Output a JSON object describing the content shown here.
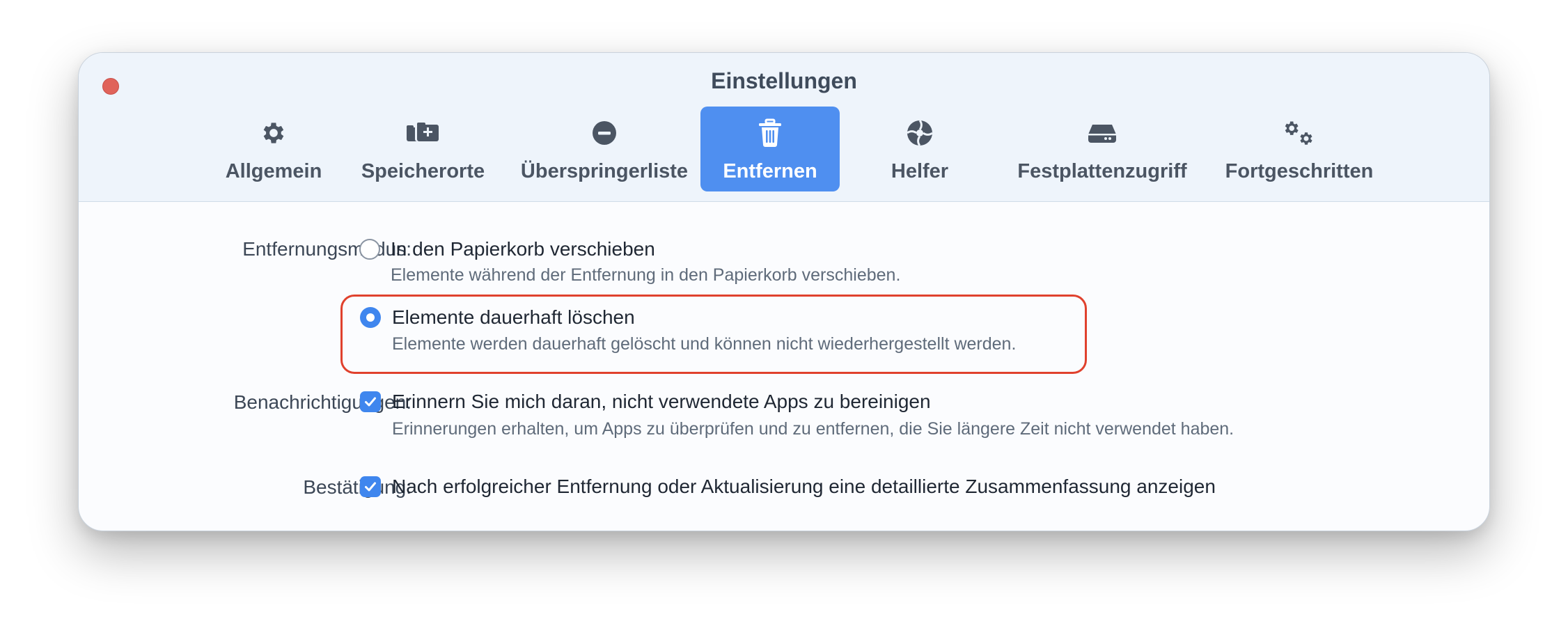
{
  "window": {
    "title": "Einstellungen"
  },
  "tabs": [
    {
      "label": "Allgemein",
      "icon": "gear-icon"
    },
    {
      "label": "Speicherorte",
      "icon": "folders-plus-icon"
    },
    {
      "label": "Überspringerliste",
      "icon": "minus-circle-icon"
    },
    {
      "label": "Entfernen",
      "icon": "trash-icon",
      "active": true
    },
    {
      "label": "Helfer",
      "icon": "helper-icon"
    },
    {
      "label": "Festplattenzugriff",
      "icon": "disk-icon"
    },
    {
      "label": "Fortgeschritten",
      "icon": "gears-icon"
    }
  ],
  "settings": {
    "removal_mode": {
      "label": "Entfernungsmodus:",
      "options": [
        {
          "title": "In den Papierkorb verschieben",
          "description": "Elemente während der Entfernung in den Papierkorb verschieben.",
          "selected": false
        },
        {
          "title": "Elemente dauerhaft löschen",
          "description": "Elemente werden dauerhaft gelöscht und können nicht wiederhergestellt werden.",
          "selected": true
        }
      ]
    },
    "notifications": {
      "label": "Benachrichtigungen:",
      "title": "Erinnern Sie mich daran, nicht verwendete Apps zu bereinigen",
      "description": "Erinnerungen erhalten, um Apps zu überprüfen und zu entfernen, die Sie längere Zeit nicht verwendet haben.",
      "checked": true
    },
    "confirmation": {
      "label": "Bestätigung:",
      "title": "Nach erfolgreicher Entfernung oder Aktualisierung eine detaillierte Zusammenfassung anzeigen",
      "checked": true
    }
  },
  "colors": {
    "accent": "#3f86ee",
    "active_tab": "#4f8ff0",
    "highlight": "#e0412d",
    "close_button": "#e0635a"
  }
}
